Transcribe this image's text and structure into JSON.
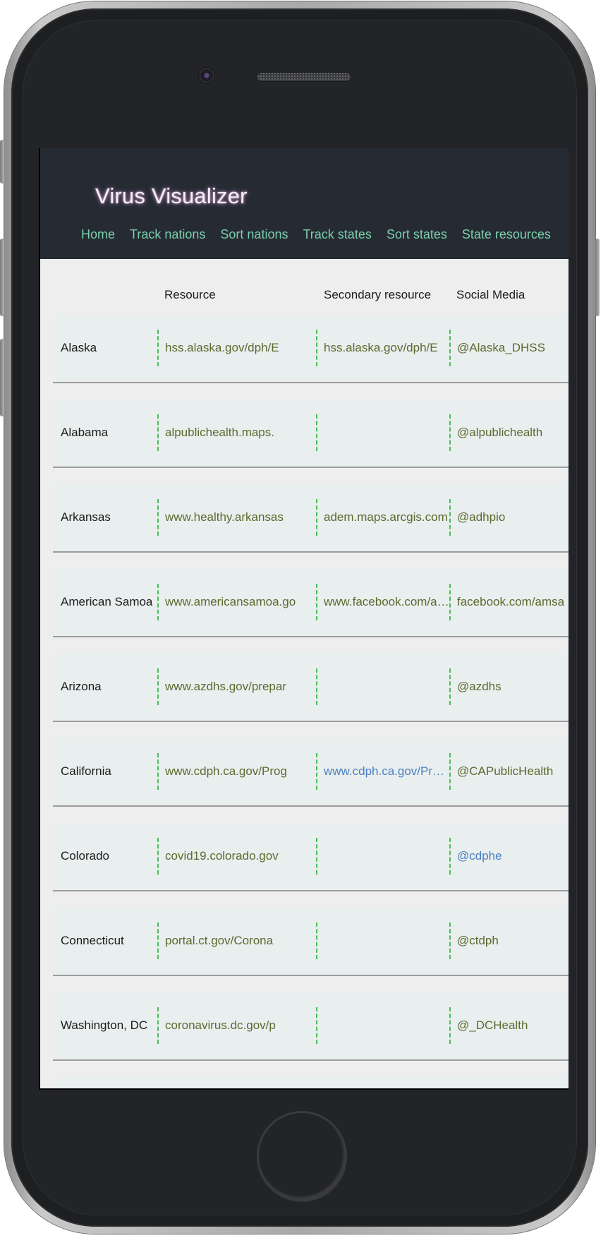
{
  "app": {
    "title": "Virus Visualizer"
  },
  "nav": [
    {
      "label": "Home"
    },
    {
      "label": "Track nations"
    },
    {
      "label": "Sort nations"
    },
    {
      "label": "Track states"
    },
    {
      "label": "Sort states"
    },
    {
      "label": "State resources"
    }
  ],
  "table": {
    "headers": {
      "resource": "Resource",
      "secondary": "Secondary resource",
      "social": "Social Media"
    },
    "rows": [
      {
        "state": "Alaska",
        "resource": "hss.alaska.gov/dph/E",
        "secondary": "hss.alaska.gov/dph/E",
        "social": "@Alaska_DHSS"
      },
      {
        "state": "Alabama",
        "resource": "alpublichealth.maps.",
        "secondary": "",
        "social": "@alpublichealth"
      },
      {
        "state": "Arkansas",
        "resource": "www.healthy.arkansas",
        "secondary": "adem.maps.arcgis.com",
        "social": "@adhpio"
      },
      {
        "state": "American Samoa",
        "resource": "www.americansamoa.go",
        "secondary": "www.facebook.com/amsa",
        "social": "facebook.com/amsa"
      },
      {
        "state": "Arizona",
        "resource": "www.azdhs.gov/prepar",
        "secondary": "",
        "social": "@azdhs"
      },
      {
        "state": "California",
        "resource": "www.cdph.ca.gov/Prog",
        "secondary": "www.cdph.ca.gov/Programs",
        "social": "@CAPublicHealth",
        "secondary_visited": true
      },
      {
        "state": "Colorado",
        "resource": "covid19.colorado.gov",
        "secondary": "",
        "social": "@cdphe",
        "social_visited": true
      },
      {
        "state": "Connecticut",
        "resource": "portal.ct.gov/Corona",
        "secondary": "",
        "social": "@ctdph"
      },
      {
        "state": "Washington, DC",
        "resource": "coronavirus.dc.gov/p",
        "secondary": "",
        "social": "@_DCHealth"
      },
      {
        "state": "",
        "resource": "",
        "secondary": "",
        "social": ""
      }
    ]
  },
  "colors": {
    "header_bg": "#262b33",
    "nav_link": "#7ccfac",
    "link": "#5c6a2f",
    "visited_link": "#4a80c2",
    "divider": "#4cbe5a"
  }
}
